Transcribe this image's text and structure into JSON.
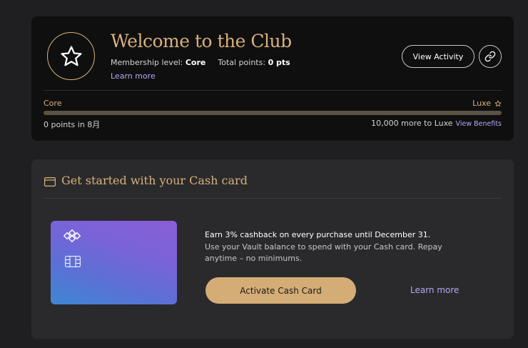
{
  "club": {
    "title": "Welcome to the Club",
    "membership_label": "Membership level:",
    "membership_value": "Core",
    "points_label": "Total points:",
    "points_value": "0 pts",
    "learn_more": "Learn more",
    "view_activity": "View Activity",
    "star_icon": "star-icon",
    "link_icon": "link-icon"
  },
  "tiers": {
    "current": "Core",
    "next": "Luxe",
    "progress_fraction": 0,
    "points_in_month": "0 points in 8月",
    "more_to_next": "10,000 more to Luxe",
    "view_benefits": "View Benefits"
  },
  "cash_card": {
    "title": "Get started with your Cash card",
    "earn_text": "Earn 3% cashback on every purchase until December 31.",
    "use_text": "Use your Vault balance to spend with your Cash card. Repay anytime – no minimums.",
    "activate_button": "Activate Cash Card",
    "learn_more": "Learn more"
  },
  "colors": {
    "gold": "#d9b07a",
    "lavender": "#b7a6f5",
    "panel_dark": "#0f0f10",
    "panel_mid": "#2a2a2c",
    "page_bg": "#1f1f21"
  }
}
